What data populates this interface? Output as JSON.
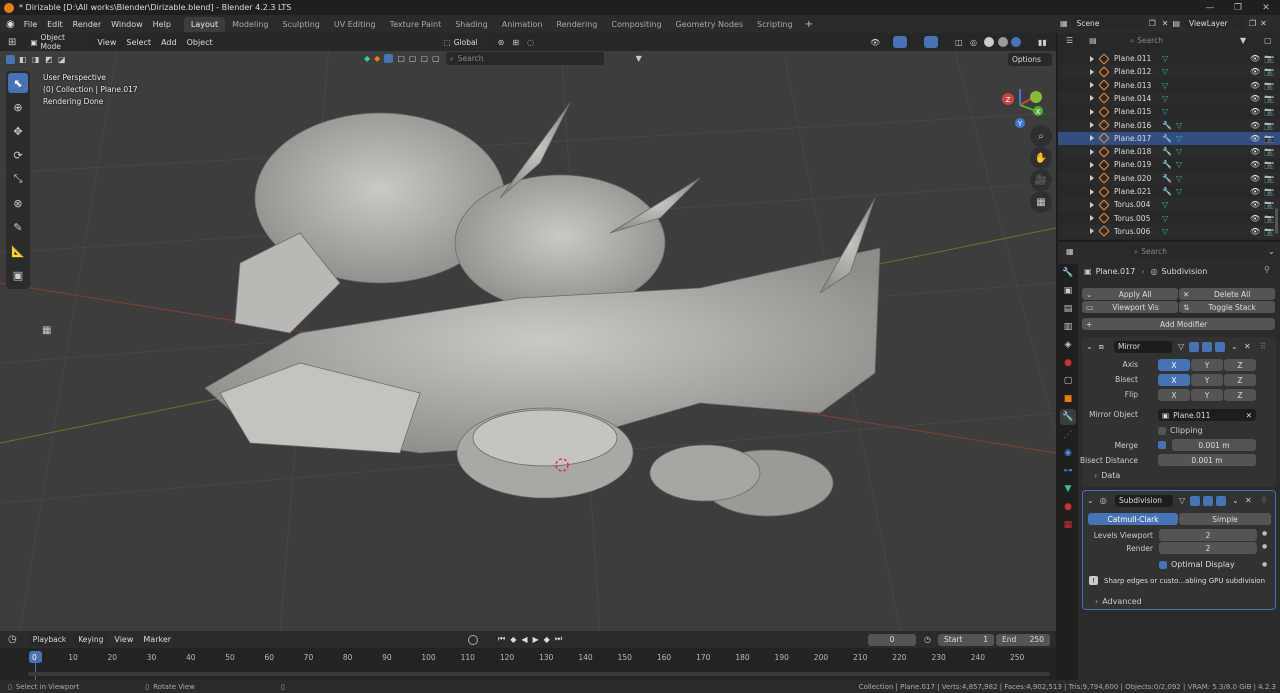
{
  "window": {
    "title": "* Dirizable [D:\\All works\\Blender\\Dirizable.blend] - Blender 4.2.3 LTS"
  },
  "menu": [
    "File",
    "Edit",
    "Render",
    "Window",
    "Help"
  ],
  "workspaces": [
    {
      "label": "Layout",
      "active": true
    },
    {
      "label": "Modeling"
    },
    {
      "label": "Sculpting"
    },
    {
      "label": "UV Editing"
    },
    {
      "label": "Texture Paint"
    },
    {
      "label": "Shading"
    },
    {
      "label": "Animation"
    },
    {
      "label": "Rendering"
    },
    {
      "label": "Compositing"
    },
    {
      "label": "Geometry Nodes"
    },
    {
      "label": "Scripting"
    }
  ],
  "scene": {
    "name": "Scene",
    "view_layer": "ViewLayer"
  },
  "viewport": {
    "mode": "Object Mode",
    "menus": [
      "View",
      "Select",
      "Add",
      "Object"
    ],
    "orientation": "Global",
    "search_placeholder": "Search",
    "options_label": "Options",
    "overlay_text": [
      "User Perspective",
      "(0) Collection | Plane.017",
      "Rendering Done"
    ],
    "gizmo": {
      "x": "X",
      "y": "Y",
      "z": "Z"
    }
  },
  "outliner": {
    "search_placeholder": "Search",
    "items": [
      {
        "name": "Plane.011",
        "mods": 1
      },
      {
        "name": "Plane.012",
        "mods": 1
      },
      {
        "name": "Plane.013",
        "mods": 1
      },
      {
        "name": "Plane.014",
        "mods": 1
      },
      {
        "name": "Plane.015",
        "mods": 1
      },
      {
        "name": "Plane.016",
        "mods": 2
      },
      {
        "name": "Plane.017",
        "mods": 2,
        "selected": true
      },
      {
        "name": "Plane.018",
        "mods": 2
      },
      {
        "name": "Plane.019",
        "mods": 2
      },
      {
        "name": "Plane.020",
        "mods": 2
      },
      {
        "name": "Plane.021",
        "mods": 2
      },
      {
        "name": "Torus.004",
        "mods": 1
      },
      {
        "name": "Torus.005",
        "mods": 1
      },
      {
        "name": "Torus.006",
        "mods": 1
      }
    ]
  },
  "properties": {
    "search_placeholder": "Search",
    "breadcrumb_object": "Plane.017",
    "breadcrumb_modifier": "Subdivision",
    "apply_all": "Apply All",
    "delete_all": "Delete All",
    "viewport_vis": "Viewport Vis",
    "toggle_stack": "Toggle Stack",
    "add_modifier": "Add Modifier",
    "mirror": {
      "name": "Mirror",
      "axis_label": "Axis",
      "bisect_label": "Bisect",
      "flip_label": "Flip",
      "x": "X",
      "y": "Y",
      "z": "Z",
      "mirror_object_label": "Mirror Object",
      "mirror_object": "Plane.011",
      "clipping_label": "Clipping",
      "merge_label": "Merge",
      "merge_value": "0.001 m",
      "bisect_distance_label": "Bisect Distance",
      "bisect_distance_value": "0.001 m",
      "data_label": "Data"
    },
    "subdivision": {
      "name": "Subdivision",
      "catmull_clark": "Catmull-Clark",
      "simple": "Simple",
      "levels_viewport_label": "Levels Viewport",
      "levels_viewport": "2",
      "render_label": "Render",
      "render": "2",
      "optimal_display": "Optimal Display",
      "warning": "Sharp edges or custo...abling GPU subdivision",
      "advanced": "Advanced"
    }
  },
  "timeline": {
    "menus": [
      "Playback",
      "Keying",
      "View",
      "Marker"
    ],
    "current_frame": "0",
    "start_label": "Start",
    "start": "1",
    "end_label": "End",
    "end": "250",
    "ticks": [
      "0",
      "10",
      "20",
      "30",
      "40",
      "50",
      "60",
      "70",
      "80",
      "90",
      "100",
      "110",
      "120",
      "130",
      "140",
      "150",
      "160",
      "170",
      "180",
      "190",
      "200",
      "210",
      "220",
      "230",
      "240",
      "250"
    ]
  },
  "statusbar": {
    "select": "Select in Viewport",
    "rotate": "Rotate View",
    "stats": "Collection | Plane.017 | Verts:4,857,982 | Faces:4,902,513 | Tris:9,794,600 | Objects:0/2,092 | VRAM: 5.3/8.0 GiB | 4.2.3"
  }
}
